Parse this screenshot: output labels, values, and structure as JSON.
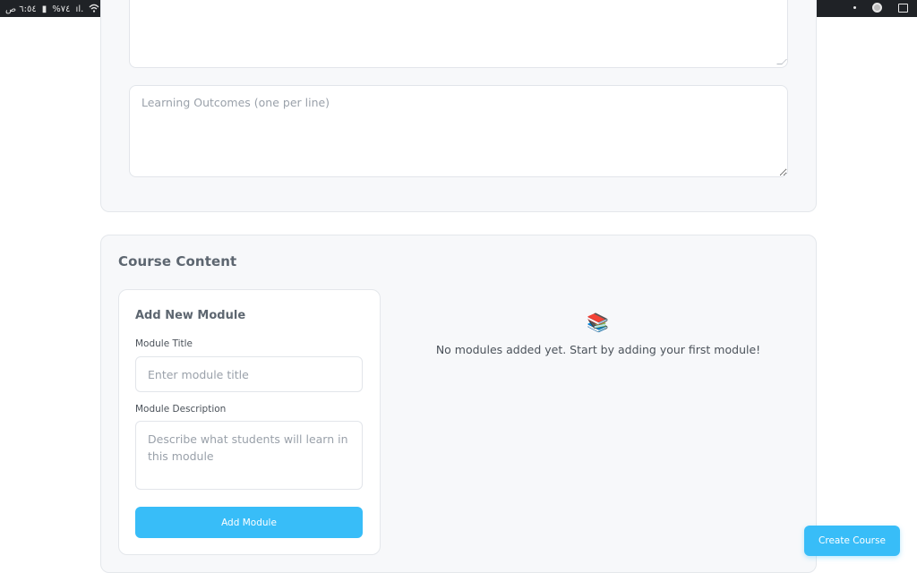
{
  "statusbar": {
    "time": "٦:٥٤ ص",
    "battery": "%٧٤",
    "signal": "ıl.",
    "icons": [
      "battery-icon",
      "signal-icon",
      "wifi-icon",
      "mute-icon",
      "bluetooth-icon",
      "dot-icon",
      "record-icon",
      "gallery-icon"
    ]
  },
  "outcomes": {
    "placeholder": "Learning Outcomes (one per line)"
  },
  "course_content": {
    "title": "Course Content",
    "form": {
      "title": "Add New Module",
      "module_title_label": "Module Title",
      "module_title_placeholder": "Enter module title",
      "module_description_label": "Module Description",
      "module_description_placeholder": "Describe what students will learn in this module",
      "add_button": "Add Module"
    },
    "empty_state": {
      "icon": "books-icon",
      "glyph": "📚",
      "message": "No modules added yet. Start by adding your first module!"
    }
  },
  "actions": {
    "create_course": "Create Course"
  },
  "colors": {
    "accent": "#38bdf8",
    "card_bg": "#f7f8fa",
    "border": "#e4e7eb",
    "heading": "#5d6670"
  }
}
